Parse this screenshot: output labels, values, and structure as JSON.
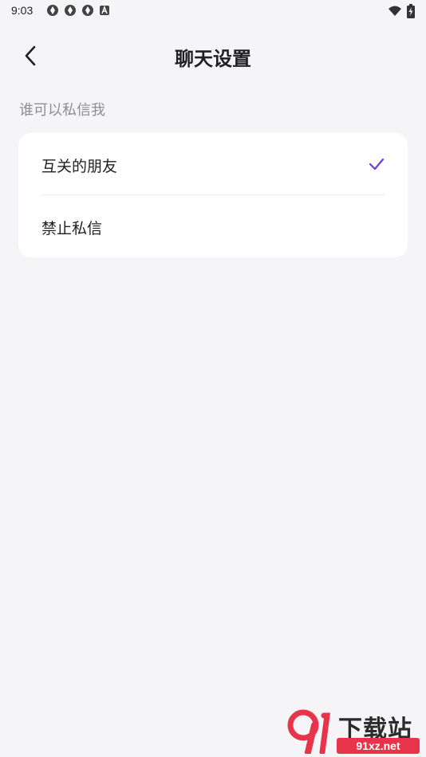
{
  "status_bar": {
    "time": "9:03",
    "icons_left": [
      "circle-badge-icon",
      "circle-badge-icon",
      "circle-badge-icon",
      "a-badge-icon"
    ],
    "icons_right": [
      "wifi-icon",
      "battery-charging-icon"
    ]
  },
  "header": {
    "title": "聊天设置",
    "back_icon": "chevron-left-icon"
  },
  "section": {
    "label": "谁可以私信我",
    "options": [
      {
        "label": "互关的朋友",
        "selected": true
      },
      {
        "label": "禁止私信",
        "selected": false
      }
    ]
  },
  "colors": {
    "background": "#f5f5f8",
    "card": "#ffffff",
    "accent": "#6c3be4",
    "secondary_text": "#8e8e96"
  },
  "watermark": {
    "title": "下载站",
    "url": "91xz.net"
  }
}
